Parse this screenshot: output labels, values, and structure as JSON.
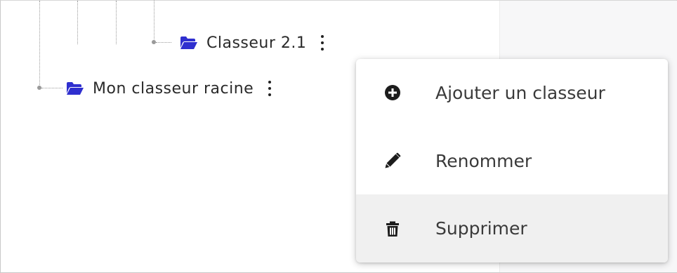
{
  "tree": {
    "nodes": [
      {
        "label": "Classeur 2.1",
        "icon": "folder-open-icon"
      },
      {
        "label": "Mon classeur racine",
        "icon": "folder-open-icon"
      }
    ]
  },
  "context_menu": {
    "items": [
      {
        "label": "Ajouter un classeur",
        "icon": "plus-circle-icon"
      },
      {
        "label": "Renommer",
        "icon": "pencil-icon"
      },
      {
        "label": "Supprimer",
        "icon": "trash-icon",
        "state": "hovered"
      }
    ]
  },
  "colors": {
    "folder": "#2f2fcf",
    "hover_bg": "#f0f0f0",
    "side_panel": "#f7f7f8"
  }
}
